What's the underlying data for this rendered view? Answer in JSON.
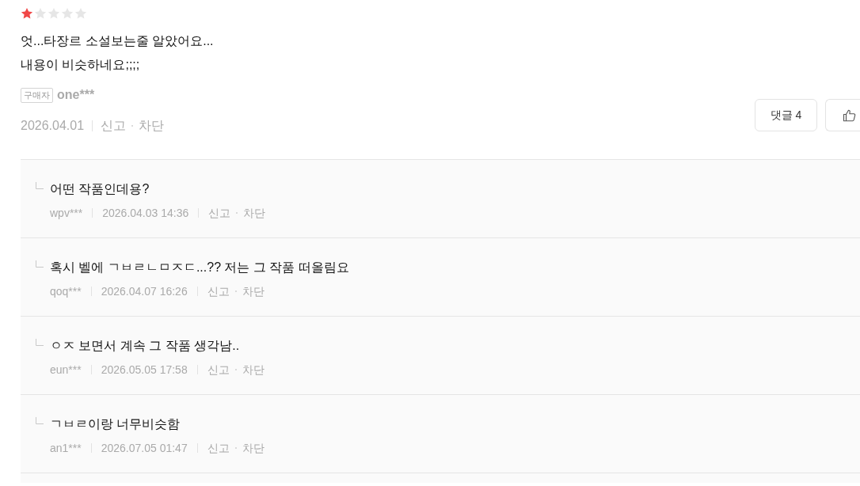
{
  "review": {
    "stars": 1,
    "text": "엇...타장르 소설보는줄 알았어요...\n내용이 비슷하네요;;;;",
    "buyer_badge": "구매자",
    "author": "one***",
    "date": "2026.04.01",
    "actions": [
      "신고",
      "차단"
    ],
    "comments_button": "댓글 4"
  },
  "replies": [
    {
      "text": "어떤 작품인데용?",
      "author": "wpv***",
      "datetime": "2026.04.03 14:36",
      "actions": [
        "신고",
        "차단"
      ]
    },
    {
      "text": "혹시 벨에 ㄱㅂㄹㄴㅁㅈㄷ...?? 저는 그 작품 떠올림요",
      "author": "qoq***",
      "datetime": "2026.04.07 16:26",
      "actions": [
        "신고",
        "차단"
      ]
    },
    {
      "text": "ㅇㅈ 보면서 계속 그 작품 생각남..",
      "author": "eun***",
      "datetime": "2026.05.05 17:58",
      "actions": [
        "신고",
        "차단"
      ]
    },
    {
      "text": "ㄱㅂㄹ이랑 너무비슷함",
      "author": "an1***",
      "datetime": "2026.07.05 01:47",
      "actions": [
        "신고",
        "차단"
      ]
    }
  ]
}
